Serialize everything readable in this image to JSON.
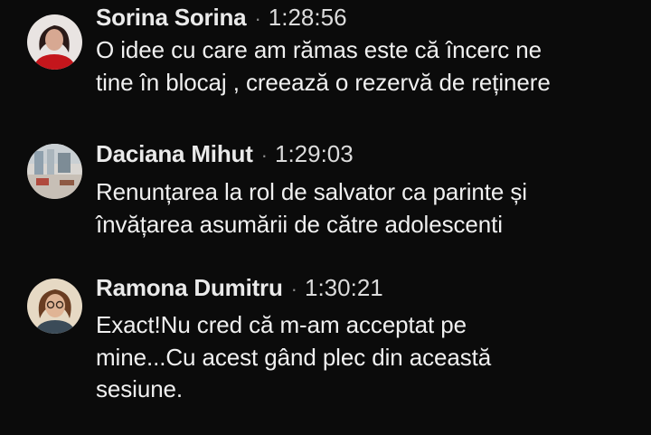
{
  "messages": [
    {
      "author": "Sorina Sorina",
      "separator": "·",
      "time": "1:28:56",
      "text": "O idee cu care am rămas este că încerc ne\ntine în blocaj , creează o rezervă de reținere",
      "avatar": "woman-dark-hair-red-top-avatar"
    },
    {
      "author": "Daciana Mihut",
      "separator": "·",
      "time": "1:29:03",
      "text": "Renunțarea la rol de salvator ca parinte și\nînvățarea asumării de către adolescenti",
      "avatar": "interior-room-photo-avatar"
    },
    {
      "author": "Ramona Dumitru",
      "separator": "·",
      "time": "1:30:21",
      "text": "Exact!Nu cred că m-am acceptat pe\nmine...Cu acest gând plec din această\nsesiune.",
      "avatar": "woman-glasses-avatar"
    }
  ],
  "colors": {
    "background": "#0b0b0b",
    "author": "#eaeaea",
    "text": "#f0f0f0",
    "separator": "#8a8a8a"
  }
}
